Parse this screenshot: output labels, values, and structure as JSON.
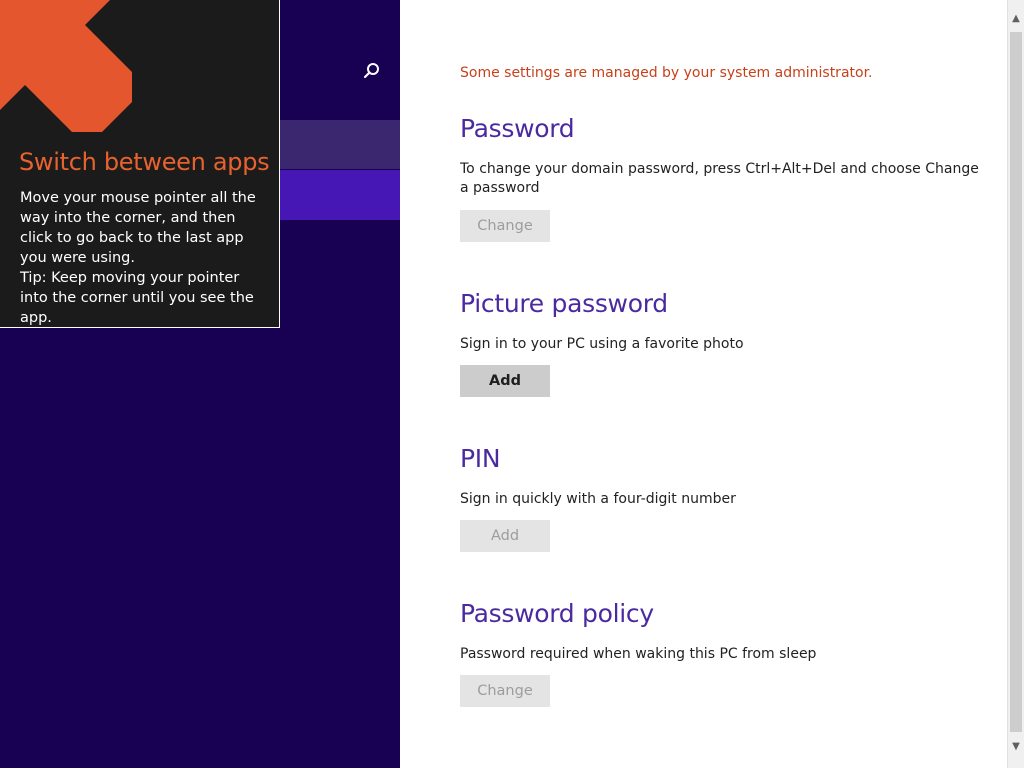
{
  "nav": {
    "search_icon": "search-icon"
  },
  "tip": {
    "title": "Switch between apps",
    "body_line1": "Move your mouse pointer all the way into the corner, and then click to go back to the last app you were using.",
    "body_line2": "Tip: Keep moving your pointer into the corner until you see the app.",
    "arrow_color": "#e4572e"
  },
  "content": {
    "admin_notice": "Some settings are managed by your system administrator.",
    "sections": [
      {
        "title": "Password",
        "description": "To change your domain password, press Ctrl+Alt+Del and choose Change a password",
        "button_label": "Change",
        "button_enabled": false
      },
      {
        "title": "Picture password",
        "description": "Sign in to your PC using a favorite photo",
        "button_label": "Add",
        "button_enabled": true
      },
      {
        "title": "PIN",
        "description": "Sign in quickly with a four-digit number",
        "button_label": "Add",
        "button_enabled": false
      },
      {
        "title": "Password policy",
        "description": "Password required when waking this PC from sleep",
        "button_label": "Change",
        "button_enabled": false
      }
    ]
  },
  "colors": {
    "nav_background": "#180052",
    "accent_purple": "#4b2aa0",
    "selected_item": "#4617b4",
    "notice_red": "#c7411a"
  }
}
